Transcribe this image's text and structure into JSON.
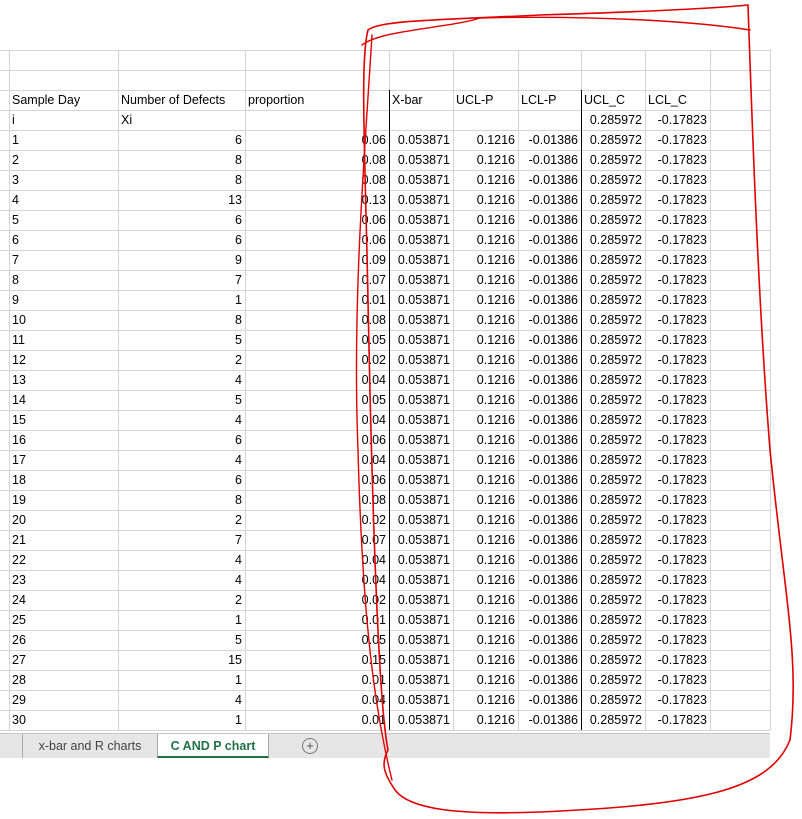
{
  "columns": [
    {
      "key": "day",
      "header": "Sample Day",
      "subheader": "i"
    },
    {
      "key": "defects",
      "header": "Number of Defects",
      "subheader": "Xi"
    },
    {
      "key": "proportion",
      "header": "proportion",
      "subheader": ""
    },
    {
      "key": "xbar",
      "header": "X-bar",
      "subheader": ""
    },
    {
      "key": "ucl_p",
      "header": "UCL-P",
      "subheader": ""
    },
    {
      "key": "lcl_p",
      "header": "LCL-P",
      "subheader": ""
    },
    {
      "key": "ucl_c",
      "header": "UCL_C",
      "subheader": "0.285972"
    },
    {
      "key": "lcl_c",
      "header": "LCL_C",
      "subheader": "-0.17823"
    }
  ],
  "rows": [
    [
      "1",
      "6",
      "0.06",
      "0.053871",
      "0.1216",
      "-0.01386",
      "0.285972",
      "-0.17823"
    ],
    [
      "2",
      "8",
      "0.08",
      "0.053871",
      "0.1216",
      "-0.01386",
      "0.285972",
      "-0.17823"
    ],
    [
      "3",
      "8",
      "0.08",
      "0.053871",
      "0.1216",
      "-0.01386",
      "0.285972",
      "-0.17823"
    ],
    [
      "4",
      "13",
      "0.13",
      "0.053871",
      "0.1216",
      "-0.01386",
      "0.285972",
      "-0.17823"
    ],
    [
      "5",
      "6",
      "0.06",
      "0.053871",
      "0.1216",
      "-0.01386",
      "0.285972",
      "-0.17823"
    ],
    [
      "6",
      "6",
      "0.06",
      "0.053871",
      "0.1216",
      "-0.01386",
      "0.285972",
      "-0.17823"
    ],
    [
      "7",
      "9",
      "0.09",
      "0.053871",
      "0.1216",
      "-0.01386",
      "0.285972",
      "-0.17823"
    ],
    [
      "8",
      "7",
      "0.07",
      "0.053871",
      "0.1216",
      "-0.01386",
      "0.285972",
      "-0.17823"
    ],
    [
      "9",
      "1",
      "0.01",
      "0.053871",
      "0.1216",
      "-0.01386",
      "0.285972",
      "-0.17823"
    ],
    [
      "10",
      "8",
      "0.08",
      "0.053871",
      "0.1216",
      "-0.01386",
      "0.285972",
      "-0.17823"
    ],
    [
      "11",
      "5",
      "0.05",
      "0.053871",
      "0.1216",
      "-0.01386",
      "0.285972",
      "-0.17823"
    ],
    [
      "12",
      "2",
      "0.02",
      "0.053871",
      "0.1216",
      "-0.01386",
      "0.285972",
      "-0.17823"
    ],
    [
      "13",
      "4",
      "0.04",
      "0.053871",
      "0.1216",
      "-0.01386",
      "0.285972",
      "-0.17823"
    ],
    [
      "14",
      "5",
      "0.05",
      "0.053871",
      "0.1216",
      "-0.01386",
      "0.285972",
      "-0.17823"
    ],
    [
      "15",
      "4",
      "0.04",
      "0.053871",
      "0.1216",
      "-0.01386",
      "0.285972",
      "-0.17823"
    ],
    [
      "16",
      "6",
      "0.06",
      "0.053871",
      "0.1216",
      "-0.01386",
      "0.285972",
      "-0.17823"
    ],
    [
      "17",
      "4",
      "0.04",
      "0.053871",
      "0.1216",
      "-0.01386",
      "0.285972",
      "-0.17823"
    ],
    [
      "18",
      "6",
      "0.06",
      "0.053871",
      "0.1216",
      "-0.01386",
      "0.285972",
      "-0.17823"
    ],
    [
      "19",
      "8",
      "0.08",
      "0.053871",
      "0.1216",
      "-0.01386",
      "0.285972",
      "-0.17823"
    ],
    [
      "20",
      "2",
      "0.02",
      "0.053871",
      "0.1216",
      "-0.01386",
      "0.285972",
      "-0.17823"
    ],
    [
      "21",
      "7",
      "0.07",
      "0.053871",
      "0.1216",
      "-0.01386",
      "0.285972",
      "-0.17823"
    ],
    [
      "22",
      "4",
      "0.04",
      "0.053871",
      "0.1216",
      "-0.01386",
      "0.285972",
      "-0.17823"
    ],
    [
      "23",
      "4",
      "0.04",
      "0.053871",
      "0.1216",
      "-0.01386",
      "0.285972",
      "-0.17823"
    ],
    [
      "24",
      "2",
      "0.02",
      "0.053871",
      "0.1216",
      "-0.01386",
      "0.285972",
      "-0.17823"
    ],
    [
      "25",
      "1",
      "0.01",
      "0.053871",
      "0.1216",
      "-0.01386",
      "0.285972",
      "-0.17823"
    ],
    [
      "26",
      "5",
      "0.05",
      "0.053871",
      "0.1216",
      "-0.01386",
      "0.285972",
      "-0.17823"
    ],
    [
      "27",
      "15",
      "0.15",
      "0.053871",
      "0.1216",
      "-0.01386",
      "0.285972",
      "-0.17823"
    ],
    [
      "28",
      "1",
      "0.01",
      "0.053871",
      "0.1216",
      "-0.01386",
      "0.285972",
      "-0.17823"
    ],
    [
      "29",
      "4",
      "0.04",
      "0.053871",
      "0.1216",
      "-0.01386",
      "0.285972",
      "-0.17823"
    ],
    [
      "30",
      "1",
      "0.01",
      "0.053871",
      "0.1216",
      "-0.01386",
      "0.285972",
      "-0.17823"
    ]
  ],
  "sheet_tabs": [
    {
      "label": "x-bar and R charts",
      "active": false
    },
    {
      "label": "C AND P chart",
      "active": true
    }
  ],
  "add_sheet_icon": "plus-circle-icon",
  "annotation": {
    "color": "#e00000"
  },
  "colors": {
    "active_tab_text": "#217346",
    "gridline": "#d4d4d4"
  }
}
